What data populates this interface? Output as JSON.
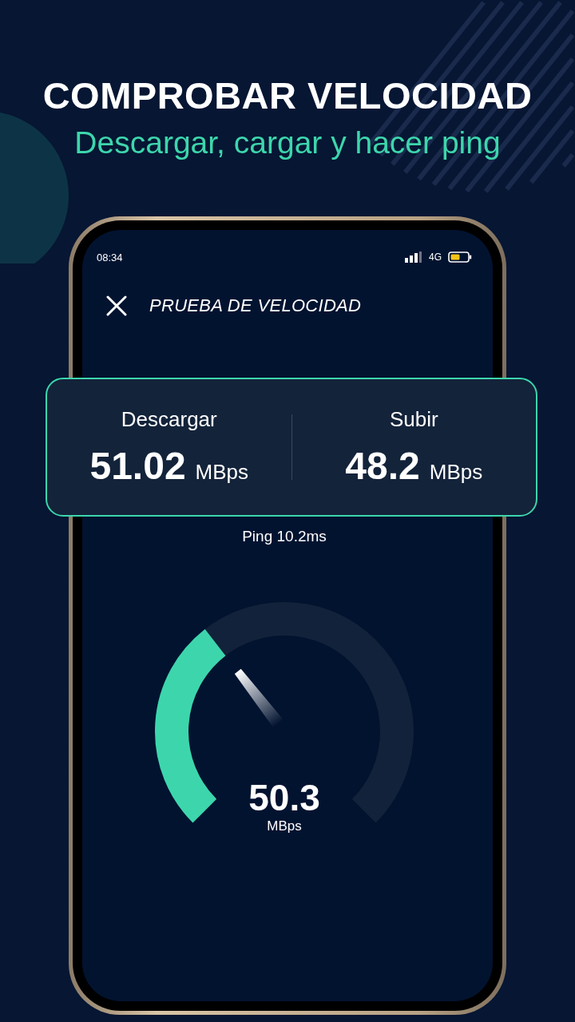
{
  "hero": {
    "title": "COMPROBAR VELOCIDAD",
    "subtitle": "Descargar, cargar y hacer ping"
  },
  "status_bar": {
    "time": "08:34",
    "network": "4G"
  },
  "app_bar": {
    "title": "PRUEBA DE VELOCIDAD"
  },
  "results": [
    {
      "label": "Descargar",
      "value": "51.02",
      "unit": "MBps"
    },
    {
      "label": "Subir",
      "value": "48.2",
      "unit": "MBps"
    }
  ],
  "ping": "Ping 10.2ms",
  "gauge": {
    "value": "50.3",
    "unit": "MBps"
  }
}
